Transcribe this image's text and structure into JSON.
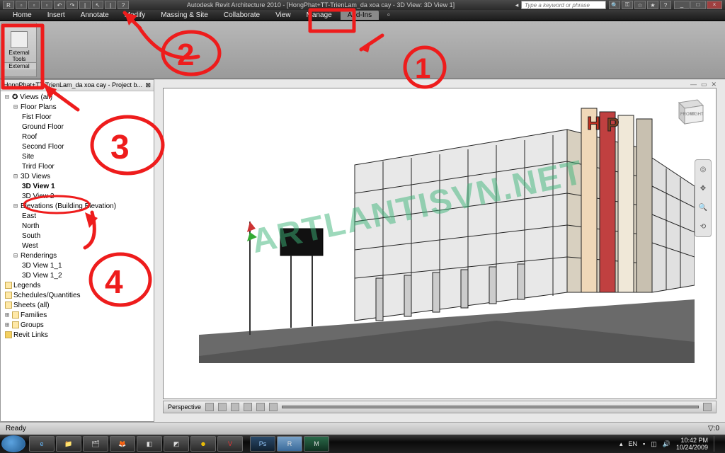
{
  "titlebar": {
    "title": "Autodesk Revit Architecture 2010 - [HongPhat+TT-TrienLam_da xoa cay - 3D View: 3D View 1]",
    "search_placeholder": "Type a keyword or phrase"
  },
  "menu": {
    "tabs": [
      "Home",
      "Insert",
      "Annotate",
      "Modify",
      "Massing & Site",
      "Collaborate",
      "View",
      "Manage",
      "Add-Ins"
    ],
    "active": "Add-Ins"
  },
  "ribbon": {
    "panel_label": "External Tools",
    "panel_footer": "External"
  },
  "browser": {
    "title": "HongPhat+TT-TrienLam_da xoa cay - Project b...",
    "views_all": "Views (all)",
    "floor_plans": "Floor Plans",
    "floors": [
      "Fist Floor",
      "Ground Floor",
      "Roof",
      "Second Floor",
      "Site",
      "Trird Floor"
    ],
    "views3d": "3D Views",
    "views3d_items": [
      "3D View 1",
      "3D View 2"
    ],
    "elevations": "Elevations (Building Elevation)",
    "elevations_items": [
      "East",
      "North",
      "South",
      "West"
    ],
    "renderings": "Renderings",
    "renderings_items": [
      "3D View 1_1",
      "3D View 1_2"
    ],
    "legends": "Legends",
    "schedules": "Schedules/Quantities",
    "sheets": "Sheets (all)",
    "families": "Families",
    "groups": "Groups",
    "links": "Revit Links"
  },
  "viewport": {
    "perspective_label": "Perspective",
    "watermark": "ARTLANTISVN.NET",
    "viewcube_front": "FRONT",
    "viewcube_right": "RIGHT",
    "sign_letter1": "H",
    "sign_letter2": "P"
  },
  "statusbar": {
    "ready": "Ready",
    "filter": "▽:0"
  },
  "taskbar": {
    "lang": "EN",
    "time": "10:42 PM",
    "date": "10/24/2009"
  },
  "annotations": {
    "n1": "1",
    "n2": "2",
    "n3": "3",
    "n4": "4"
  }
}
